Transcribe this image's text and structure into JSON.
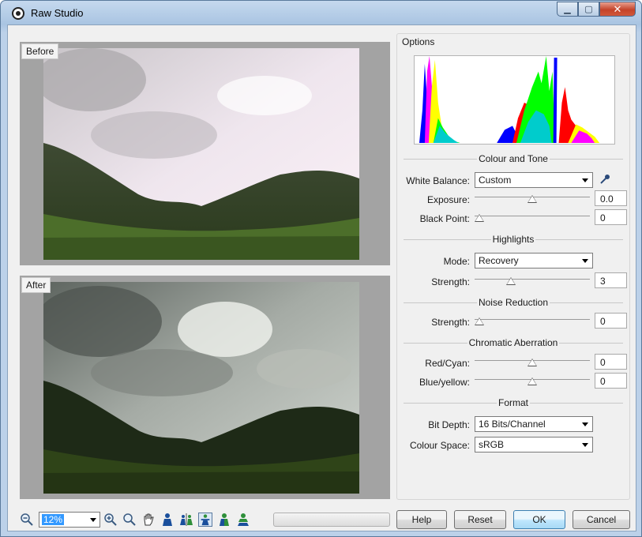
{
  "window": {
    "title": "Raw Studio"
  },
  "previews": {
    "before_label": "Before",
    "after_label": "After"
  },
  "options": {
    "group_title": "Options",
    "colour_and_tone": {
      "section_title": "Colour and Tone",
      "white_balance_label": "White Balance:",
      "white_balance_value": "Custom",
      "exposure_label": "Exposure:",
      "exposure_value": "0.0",
      "exposure_level": 0.5,
      "black_point_label": "Black Point:",
      "black_point_value": "0",
      "black_point_level": 0.0
    },
    "highlights": {
      "section_title": "Highlights",
      "mode_label": "Mode:",
      "mode_value": "Recovery",
      "strength_label": "Strength:",
      "strength_value": "3",
      "strength_level": 0.3
    },
    "noise_reduction": {
      "section_title": "Noise Reduction",
      "strength_label": "Strength:",
      "strength_value": "0",
      "strength_level": 0.0
    },
    "chromatic_aberration": {
      "section_title": "Chromatic Aberration",
      "red_cyan_label": "Red/Cyan:",
      "red_cyan_value": "0",
      "red_cyan_level": 0.5,
      "blue_yellow_label": "Blue/yellow:",
      "blue_yellow_value": "0",
      "blue_yellow_level": 0.5
    },
    "format": {
      "section_title": "Format",
      "bit_depth_label": "Bit Depth:",
      "bit_depth_value": "16 Bits/Channel",
      "colour_space_label": "Colour Space:",
      "colour_space_value": "sRGB"
    }
  },
  "toolbar": {
    "zoom_value": "12%"
  },
  "buttons": {
    "help": "Help",
    "reset": "Reset",
    "ok": "OK",
    "cancel": "Cancel"
  }
}
